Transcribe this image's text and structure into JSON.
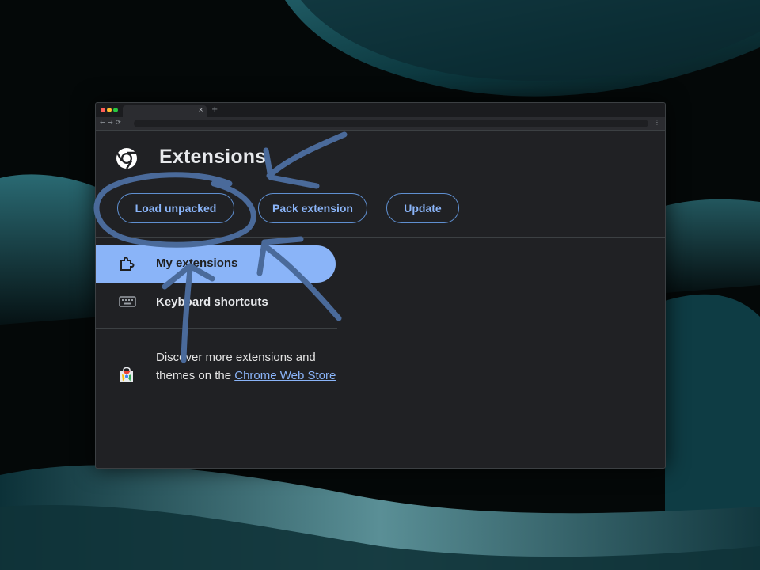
{
  "colors": {
    "accent": "#8ab4f8",
    "page_bg": "#202124",
    "annotation": "#4a6a9a",
    "pill_border": "#5f8fd0"
  },
  "browser": {
    "tab_close": "×",
    "new_tab": "+",
    "nav_back": "←",
    "nav_forward": "→",
    "nav_reload": "⟳",
    "menu": "⋮"
  },
  "header": {
    "title": "Extensions",
    "logo_icon": "chrome-logo-icon",
    "buttons": {
      "load_unpacked": "Load unpacked",
      "pack_extension": "Pack extension",
      "update": "Update"
    }
  },
  "sidebar": {
    "items": [
      {
        "label": "My extensions",
        "icon": "puzzle-icon",
        "selected": true
      },
      {
        "label": "Keyboard shortcuts",
        "icon": "keyboard-icon",
        "selected": false
      }
    ],
    "store": {
      "text_before": "Discover more extensions and themes on the ",
      "link_text": "Chrome Web Store",
      "icon": "web-store-icon"
    }
  },
  "annotations": [
    "arrow-to-title",
    "circle-around-load-unpacked",
    "arrow-to-pack-extension",
    "arrow-to-my-extensions"
  ]
}
